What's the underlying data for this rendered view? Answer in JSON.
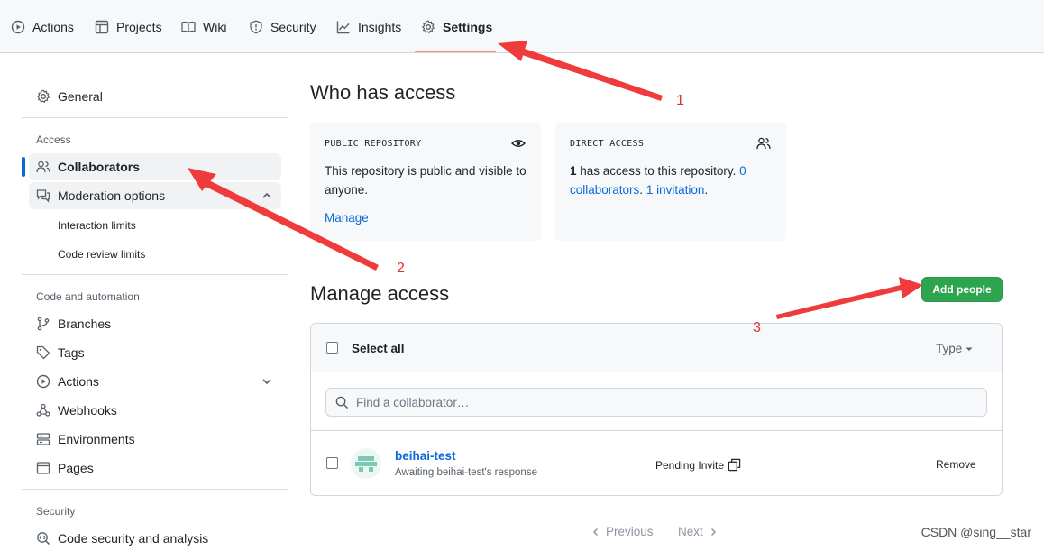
{
  "topnav": {
    "tabs": [
      {
        "label": "Actions"
      },
      {
        "label": "Projects"
      },
      {
        "label": "Wiki"
      },
      {
        "label": "Security"
      },
      {
        "label": "Insights"
      },
      {
        "label": "Settings"
      }
    ],
    "selected": "Settings"
  },
  "sidebar": {
    "general": "General",
    "access_heading": "Access",
    "collaborators": "Collaborators",
    "moderation": "Moderation options",
    "interaction_limits": "Interaction limits",
    "code_review_limits": "Code review limits",
    "code_automation_heading": "Code and automation",
    "branches": "Branches",
    "tags": "Tags",
    "actions": "Actions",
    "webhooks": "Webhooks",
    "environments": "Environments",
    "pages": "Pages",
    "security_heading": "Security",
    "code_security": "Code security and analysis"
  },
  "who_has_access": {
    "title": "Who has access",
    "public_card": {
      "label": "PUBLIC REPOSITORY",
      "text": "This repository is public and visible to anyone.",
      "link": "Manage"
    },
    "direct_card": {
      "label": "DIRECT ACCESS",
      "count": "1",
      "text": " has access to this repository. ",
      "collab_link": "0 collaborators",
      "sep": ". ",
      "invite_link": "1 invitation",
      "end": "."
    }
  },
  "manage_access": {
    "title": "Manage access",
    "add_button": "Add people",
    "select_all": "Select all",
    "type_filter": "Type",
    "search_placeholder": "Find a collaborator…",
    "rows": [
      {
        "name": "beihai-test",
        "subtitle": "Awaiting beihai-test's response",
        "status": "Pending Invite",
        "action": "Remove"
      }
    ]
  },
  "pagination": {
    "previous": "Previous",
    "next": "Next"
  },
  "annotations": {
    "n1": "1",
    "n2": "2",
    "n3": "3"
  },
  "watermark": "CSDN @sing__star",
  "colors": {
    "accent": "#0969da",
    "green": "#2da44e",
    "annotation_red": "#e03131",
    "tab_underline": "#fd8c73"
  }
}
